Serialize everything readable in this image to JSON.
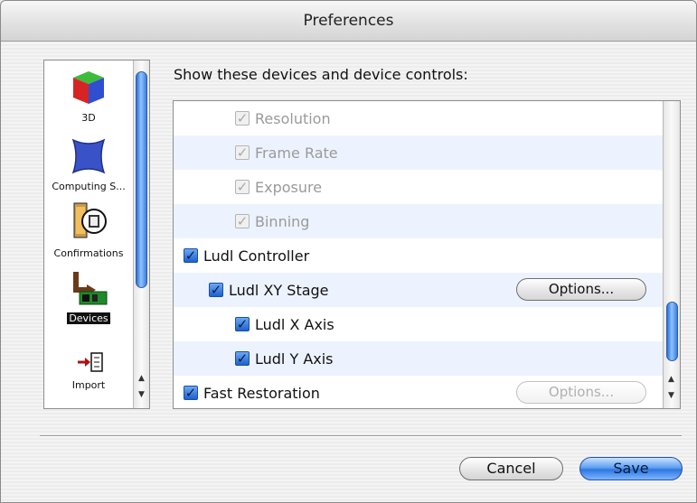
{
  "window": {
    "title": "Preferences"
  },
  "sidebar": {
    "items": [
      {
        "label": "3D",
        "icon": "cube-icon",
        "selected": false
      },
      {
        "label": "Computing S...",
        "icon": "computing-shape-icon",
        "selected": false
      },
      {
        "label": "Confirmations",
        "icon": "confirmation-icon",
        "selected": false
      },
      {
        "label": "Devices",
        "icon": "devices-icon",
        "selected": true
      },
      {
        "label": "Import",
        "icon": "import-icon",
        "selected": false
      }
    ]
  },
  "main": {
    "heading": "Show these devices and device controls:",
    "rows": [
      {
        "label": "Resolution",
        "checked": true,
        "enabled": false
      },
      {
        "label": "Frame Rate",
        "checked": true,
        "enabled": false
      },
      {
        "label": "Exposure",
        "checked": true,
        "enabled": false
      },
      {
        "label": "Binning",
        "checked": true,
        "enabled": false
      },
      {
        "label": "Ludl Controller",
        "checked": true,
        "enabled": true
      },
      {
        "label": "Ludl XY Stage",
        "checked": true,
        "enabled": true,
        "options": "Options...",
        "options_enabled": true
      },
      {
        "label": "Ludl X Axis",
        "checked": true,
        "enabled": true
      },
      {
        "label": "Ludl Y Axis",
        "checked": true,
        "enabled": true
      },
      {
        "label": "Fast Restoration",
        "checked": true,
        "enabled": true,
        "options": "Options...",
        "options_enabled": false
      }
    ]
  },
  "footer": {
    "cancel_label": "Cancel",
    "save_label": "Save"
  },
  "colors": {
    "accent": "#2f76e0",
    "row_alt": "#edf3fe"
  }
}
